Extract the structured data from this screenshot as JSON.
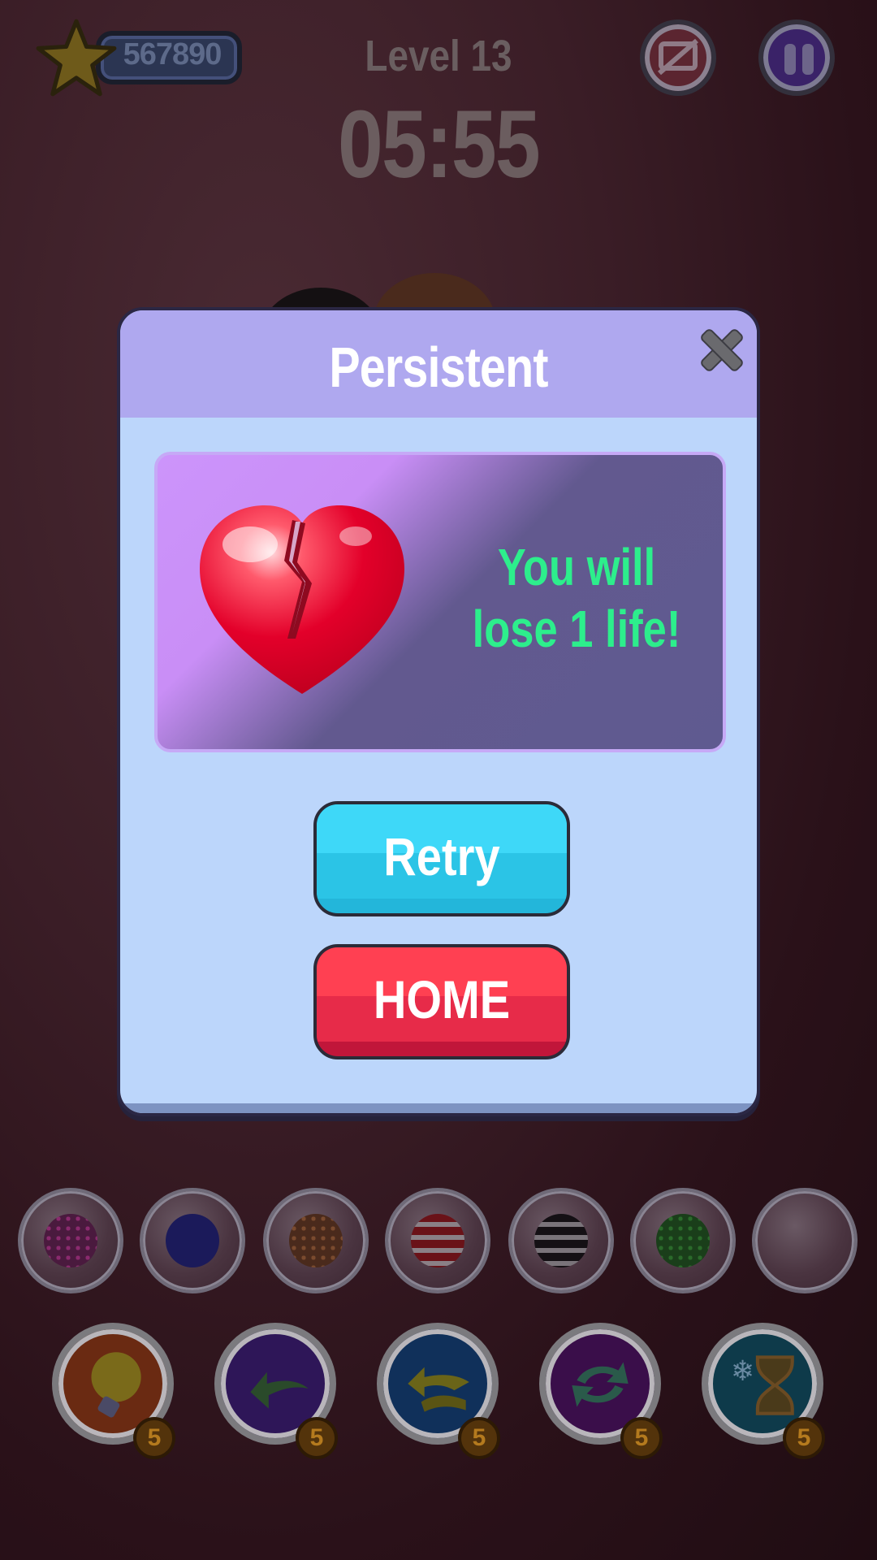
{
  "hud": {
    "score": "567890",
    "level": "Level 13",
    "timer": "05:55"
  },
  "dialog": {
    "title": "Persistent",
    "message_line1": "You will",
    "message_line2": "lose 1 life!",
    "retry_label": "Retry",
    "home_label": "HOME"
  },
  "tray": {
    "slots": [
      {
        "ball": "pink-dotted"
      },
      {
        "ball": "blue"
      },
      {
        "ball": "brown-dotted"
      },
      {
        "ball": "red-striped"
      },
      {
        "ball": "black-striped"
      },
      {
        "ball": "green-dotted"
      },
      {
        "ball": "empty"
      }
    ]
  },
  "powerups": [
    {
      "name": "hint",
      "icon": "lightbulb-icon",
      "count": "5"
    },
    {
      "name": "undo",
      "icon": "undo-arrow-icon",
      "count": "5"
    },
    {
      "name": "shuffle",
      "icon": "shuffle-icon",
      "count": "5"
    },
    {
      "name": "swap",
      "icon": "swap-icon",
      "count": "5"
    },
    {
      "name": "freeze-time",
      "icon": "hourglass-snowflake-icon",
      "count": "5"
    }
  ],
  "colors": {
    "dialog_bg": "#bcd6fb",
    "dialog_header": "#afa8ef",
    "message": "#2dee8c",
    "retry": "#2bc4e6",
    "home": "#e72b49"
  }
}
